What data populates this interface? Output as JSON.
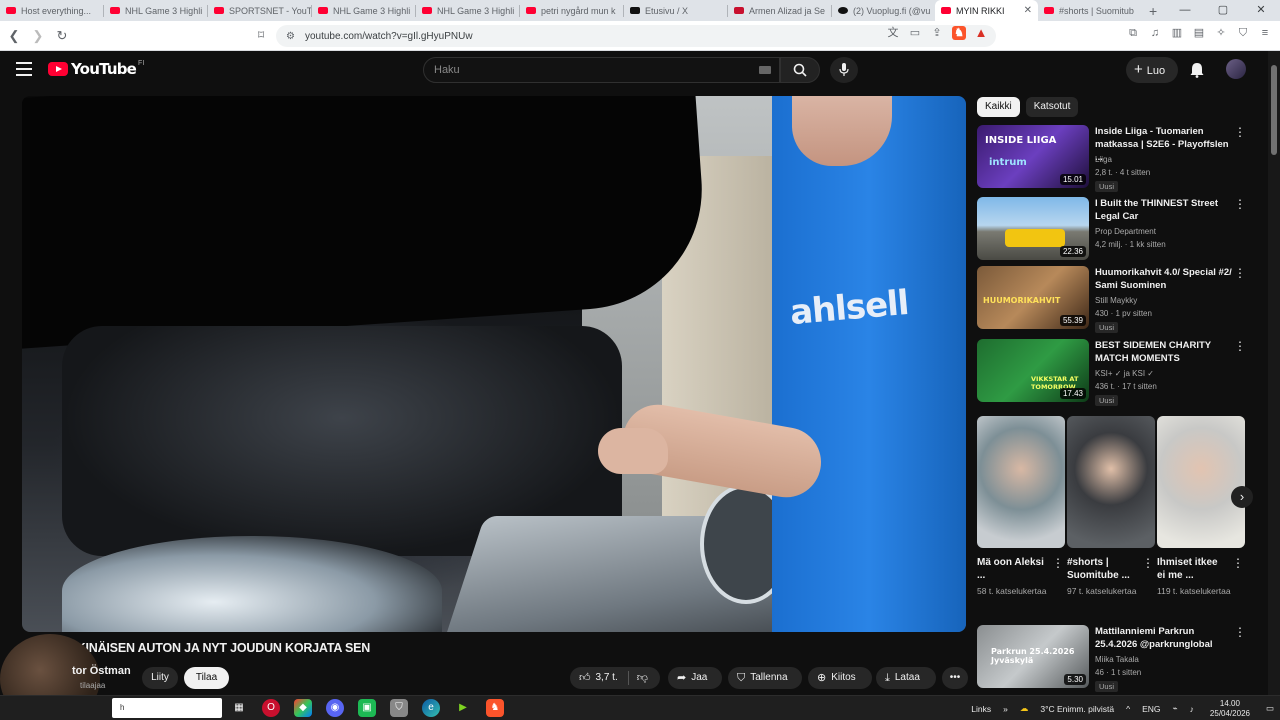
{
  "browser": {
    "tabs": [
      {
        "title": "Host everything...",
        "icon": "youtube-icon"
      },
      {
        "title": "NHL Game 3 Highli",
        "icon": "youtube-icon"
      },
      {
        "title": "SPORTSNET - YouTu",
        "icon": "youtube-icon"
      },
      {
        "title": "NHL Game 3 Highli",
        "icon": "youtube-icon"
      },
      {
        "title": "NHL Game 3 Highli",
        "icon": "youtube-icon"
      },
      {
        "title": "petri nygård mun k",
        "icon": "youtube-icon"
      },
      {
        "title": "Etusivu / X",
        "icon": "x-icon"
      },
      {
        "title": "Armen Alizad ja Se",
        "icon": "sports-icon"
      },
      {
        "title": "(2) Vuoplug.fi (@vu",
        "icon": "tiktok-icon"
      },
      {
        "title": "MYIN RIKKI",
        "icon": "youtube-icon",
        "active": true
      },
      {
        "title": "#shorts | Suomitub",
        "icon": "youtube-icon"
      }
    ],
    "url": "youtube.com/watch?v=gIl.gHyuPNUw",
    "window_controls": [
      "—",
      "▢",
      "✕"
    ]
  },
  "youtube": {
    "logo_text": "YouTube",
    "country_code": "FI",
    "search_placeholder": "Haku",
    "create_label": "Luo",
    "video": {
      "title": "MYIN RIKKINÄISEN AUTON JA NYT JOUDUN KORJATA SEN",
      "shirt_text": "ahlsell",
      "channel_name": "tor Östman",
      "channel_sub": "tilaajaa",
      "join_label": "Liity",
      "subscribe_label": "Tilaa",
      "likes": "3,7 t.",
      "share_label": "Jaa",
      "save_label": "Tallenna",
      "thanks_label": "Kiitos",
      "download_label": "Lataa"
    },
    "chips": [
      "Kaikki",
      "Katsotut"
    ],
    "recommendations": [
      {
        "title": "Inside Liiga - Tuomarien matkassa | S2E6 - Playoffslen ...",
        "channel": "Liiga",
        "views": "2,8 t.",
        "age": "4 t sitten",
        "duration": "15.01",
        "badge": "Uusi"
      },
      {
        "title": "I Built the THINNEST Street Legal Car",
        "channel": "Prop Department",
        "views": "4,2 milj.",
        "age": "1 kk sitten",
        "duration": "22.36",
        "badge": ""
      },
      {
        "title": "Huumorikahvit 4.0/ Special #2/ Sami Suominen",
        "channel": "Still Maykky",
        "views": "430",
        "age": "1 pv sitten",
        "duration": "55.39",
        "badge": "Uusi"
      },
      {
        "title": "BEST SIDEMEN CHARITY MATCH MOMENTS",
        "channel": "KSI+ ✓ ja KSI ✓",
        "views": "436 t.",
        "age": "17 t sitten",
        "duration": "17.43",
        "badge": "Uusi"
      },
      {
        "title": "Mattilanniemi Parkrun 25.4.2026 @parkrunglobal",
        "channel": "Miika Takala",
        "views": "46",
        "age": "1 t sitten",
        "duration": "5.30",
        "badge": "Uusi"
      }
    ],
    "shorts": [
      {
        "title": "Mä oon Aleksi ...",
        "views": "58 t. katselukertaa"
      },
      {
        "title": "#shorts | Suomitube ...",
        "views": "97 t. katselukertaa"
      },
      {
        "title": "Ihmiset itkee ei me ...",
        "views": "119 t. katselukertaa"
      }
    ],
    "thumb_labels": {
      "liiga": "INSIDE LIIGA",
      "liiga_sub": "intrum",
      "huumori": "HUUMORIKAHVIT",
      "ksi": "VIKKSTAR AT TOMORROW",
      "parkrun": "Parkrun 25.4.2026 Jyväskylä"
    }
  },
  "taskbar": {
    "search_text": "h",
    "links_label": "Links",
    "weather": "3°C  Enimm. pilvistä",
    "lang": "ENG",
    "time": "14.00",
    "date": "25/04/2026"
  },
  "colors": {
    "youtube_red": "#ff0033",
    "bg": "#0f0f0f",
    "shirt_blue": "#2a84e6"
  }
}
